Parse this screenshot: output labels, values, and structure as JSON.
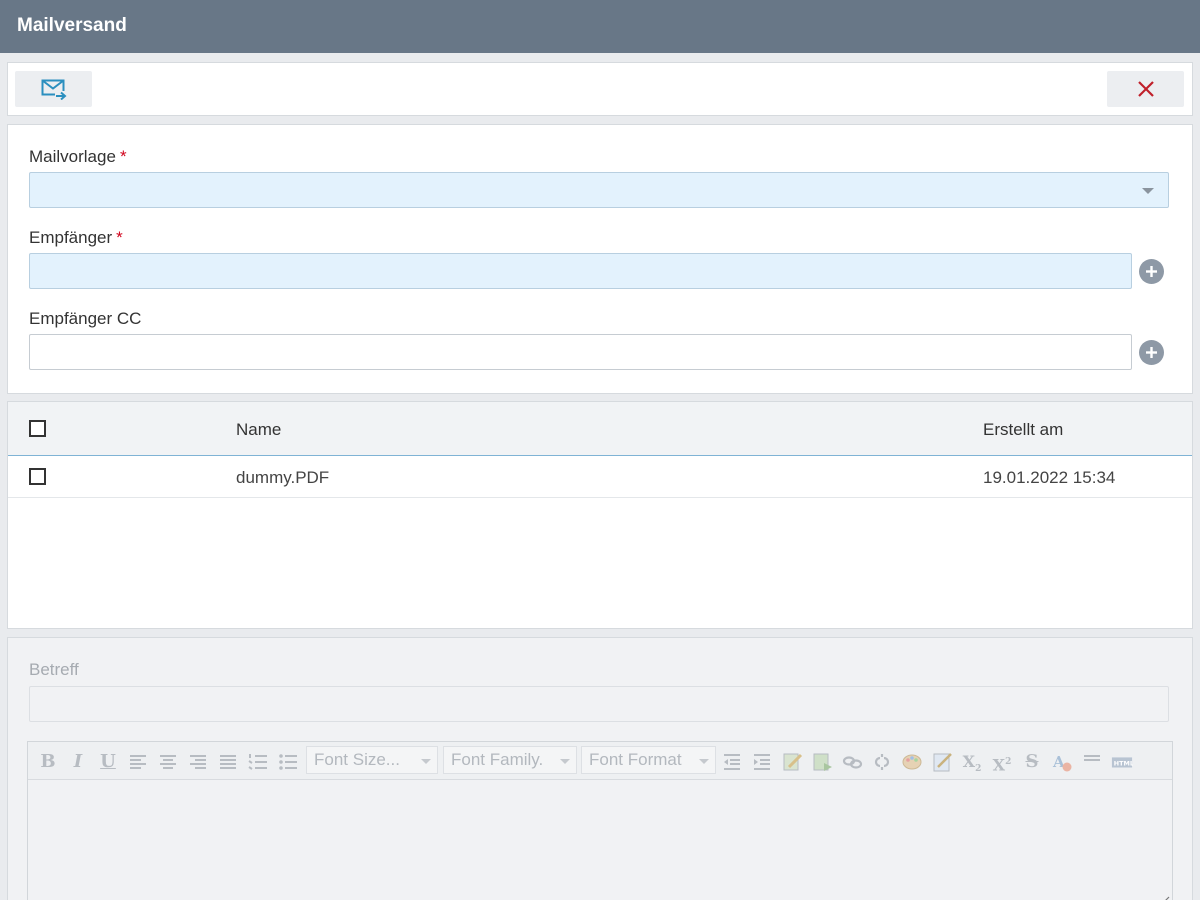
{
  "window": {
    "title": "Mailversand"
  },
  "toolbar": {
    "send_icon": "mail-send-icon",
    "close_icon": "close-icon",
    "close_color": "#c0202b"
  },
  "form": {
    "template_label": "Mailvorlage",
    "recipient_label": "Empfänger",
    "cc_label": "Empfänger CC",
    "required_mark": "*",
    "template_value": "",
    "recipient_value": "",
    "cc_value": ""
  },
  "attachments": {
    "columns": [
      "Name",
      "Erstellt am"
    ],
    "rows": [
      {
        "name": "dummy.PDF",
        "created": "19.01.2022 15:34",
        "checked": false
      }
    ]
  },
  "mail": {
    "subject_label": "Betreff",
    "subject_value": "",
    "editor_toolbar": {
      "font_size": "Font Size...",
      "font_family": "Font Family.",
      "font_format": "Font Format"
    }
  },
  "colors": {
    "titlebar": "#687787",
    "required_field": "#e3f2fd",
    "required_mark": "#d0021b",
    "send_icon": "#2b8fbf"
  }
}
